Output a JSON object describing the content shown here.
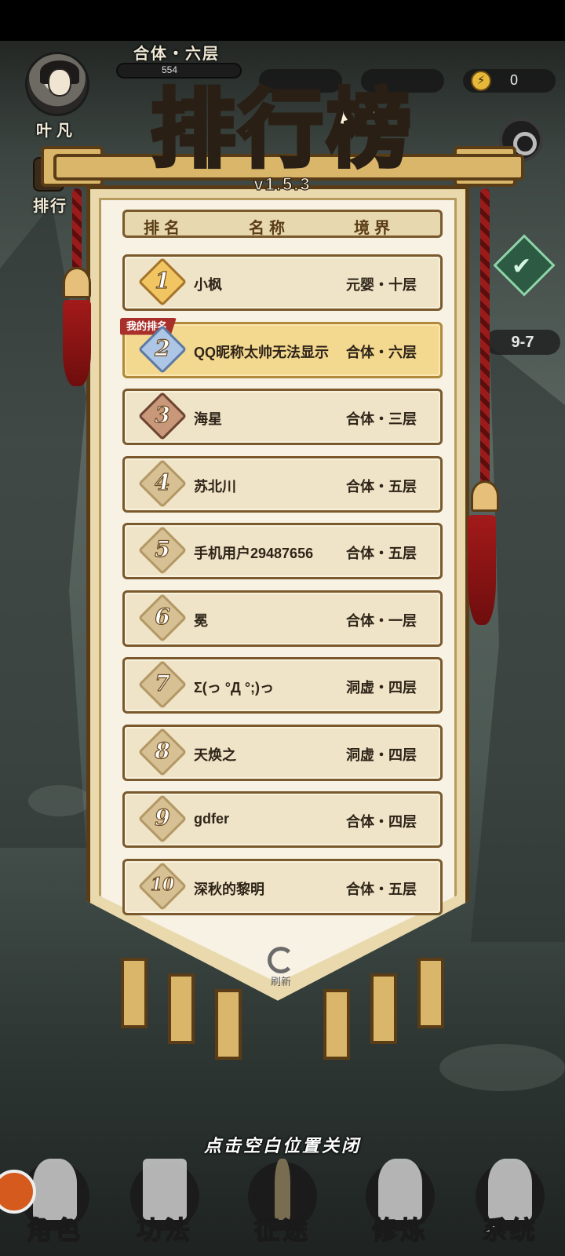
{
  "hud": {
    "player_name": "叶凡",
    "realm": "合体・六层",
    "xp_value": "554",
    "energy_value": "0",
    "energy_icon": "lightning-icon",
    "side_label": "排行",
    "stage": "9-7"
  },
  "leaderboard": {
    "title": "排行榜",
    "version": "v1.5.3",
    "headers": {
      "rank": "排名",
      "name": "名称",
      "realm": "境界"
    },
    "my_rank_tag": "我的排名",
    "rows": [
      {
        "rank": "1",
        "name": "小枫",
        "realm": "元婴・十层"
      },
      {
        "rank": "2",
        "name": "QQ昵称太帅无法显示",
        "realm": "合体・六层"
      },
      {
        "rank": "3",
        "name": "海星",
        "realm": "合体・三层"
      },
      {
        "rank": "4",
        "name": "苏北川",
        "realm": "合体・五层"
      },
      {
        "rank": "5",
        "name": "手机用户29487656",
        "realm": "合体・五层"
      },
      {
        "rank": "6",
        "name": "冕",
        "realm": "合体・一层"
      },
      {
        "rank": "7",
        "name": "Σ(っ °Д °;)っ",
        "realm": "洞虚・四层"
      },
      {
        "rank": "8",
        "name": "天焕之",
        "realm": "洞虚・四层"
      },
      {
        "rank": "9",
        "name": "gdfer",
        "realm": "合体・四层"
      },
      {
        "rank": "10",
        "name": "深秋的黎明",
        "realm": "合体・五层"
      }
    ],
    "refresh_label": "刷新"
  },
  "close_hint": "点击空白位置关闭",
  "nav": {
    "items": [
      {
        "label": "角色"
      },
      {
        "label": "功法"
      },
      {
        "label": "征途"
      },
      {
        "label": "修炼"
      },
      {
        "label": "系统"
      }
    ]
  },
  "colors": {
    "gold": "#f1c662",
    "silver": "#aec6e6",
    "bronze": "#c9977a",
    "my_row": "#f3d890",
    "tag_red": "#a9302a"
  }
}
